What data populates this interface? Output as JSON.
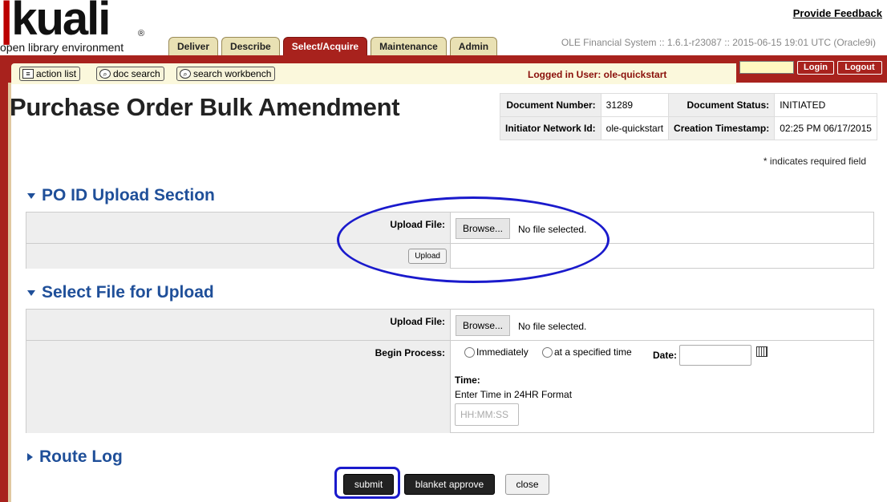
{
  "header": {
    "logo_letters": "kuali",
    "logo_reg": "®",
    "logo_tagline": "open library environment",
    "feedback": "Provide Feedback",
    "version": "OLE Financial System :: 1.6.1-r23087 :: 2015-06-15 19:01 UTC (Oracle9i)",
    "tabs": [
      {
        "label": "Deliver",
        "active": false
      },
      {
        "label": "Describe",
        "active": false
      },
      {
        "label": "Select/Acquire",
        "active": true
      },
      {
        "label": "Maintenance",
        "active": false
      },
      {
        "label": "Admin",
        "active": false
      }
    ]
  },
  "toolbar": {
    "action_list": "action list",
    "doc_search": "doc search",
    "search_workbench": "search workbench",
    "logged_in": "Logged in User: ole-quickstart",
    "login": "Login",
    "logout": "Logout"
  },
  "page": {
    "title": "Purchase Order Bulk Amendment",
    "required_note": "* indicates required field"
  },
  "docinfo": {
    "doc_number_label": "Document Number:",
    "doc_number": "31289",
    "doc_status_label": "Document Status:",
    "doc_status": "INITIATED",
    "initiator_label": "Initiator Network Id:",
    "initiator": "ole-quickstart",
    "timestamp_label": "Creation Timestamp:",
    "timestamp": "02:25 PM 06/17/2015"
  },
  "section1": {
    "title": "PO ID Upload Section",
    "upload_label": "Upload File:",
    "browse": "Browse...",
    "no_file": "No file selected.",
    "upload_button": "Upload"
  },
  "section2": {
    "title": "Select File for Upload",
    "upload_label": "Upload File:",
    "browse": "Browse...",
    "no_file": "No file selected.",
    "begin_label": "Begin Process:",
    "opt_immediately": "Immediately",
    "opt_specified": "at a specified time",
    "date_label": "Date:",
    "time_label": "Time:",
    "time_hint": "Enter Time in 24HR Format",
    "time_placeholder": "HH:MM:SS"
  },
  "section3": {
    "title": "Route Log"
  },
  "buttons": {
    "submit": "submit",
    "blanket_approve": "blanket approve",
    "close": "close"
  },
  "colors": {
    "accent_red": "#a8221d",
    "section_blue": "#1f4f99",
    "annotation_blue": "#1a1acc"
  }
}
